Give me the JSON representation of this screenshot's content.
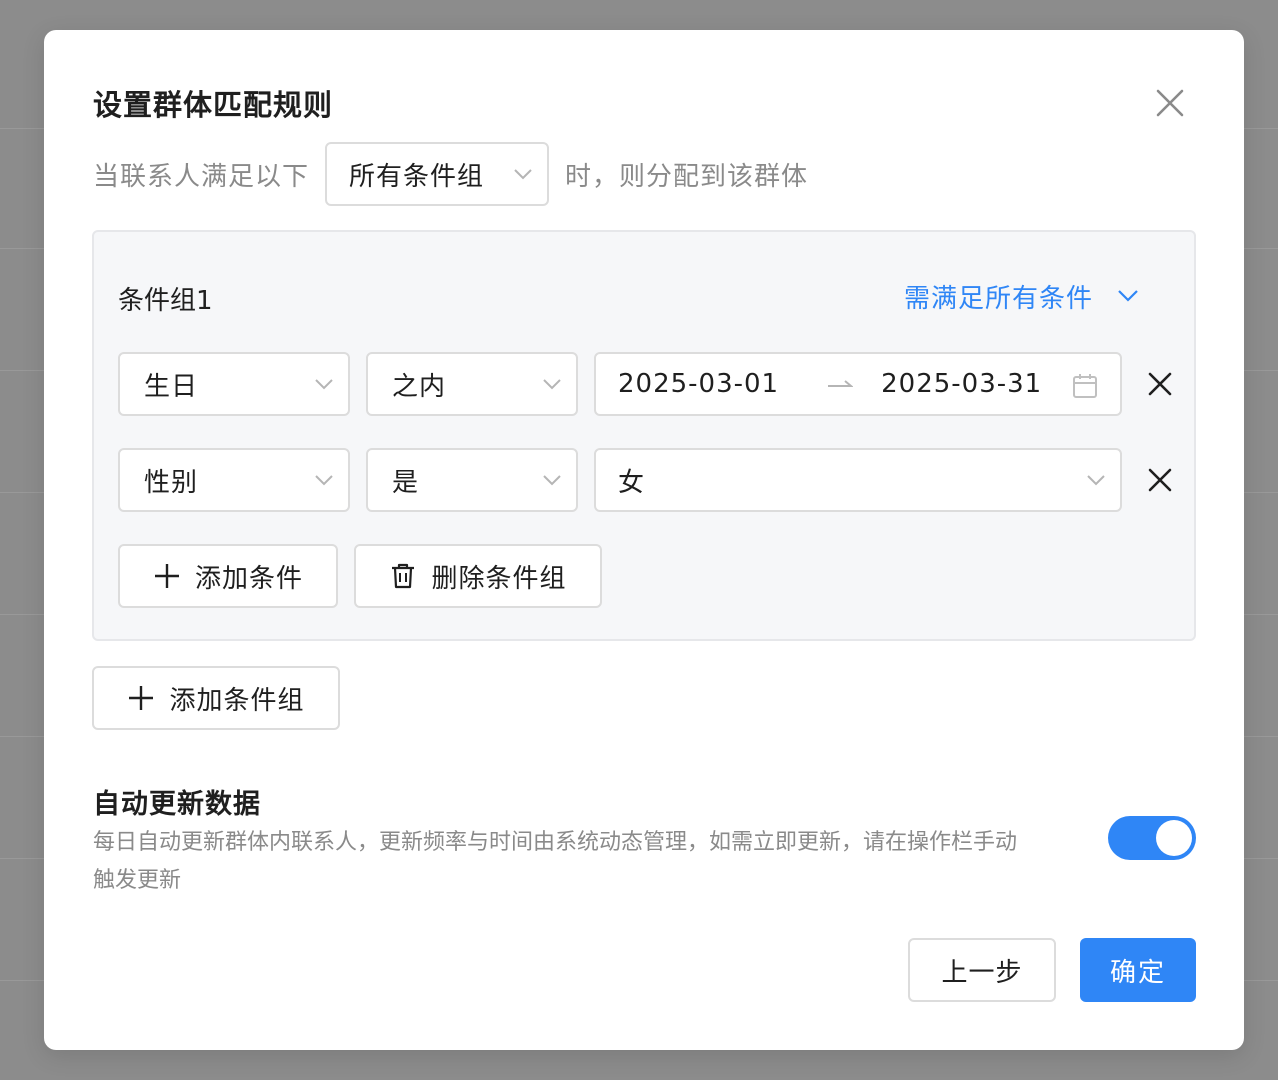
{
  "dialog": {
    "title": "设置群体匹配规则",
    "rule_prefix": "当联系人满足以下",
    "rule_select_value": "所有条件组",
    "rule_suffix": "时，则分配到该群体"
  },
  "condition_group": {
    "title": "条件组1",
    "mode": "需满足所有条件",
    "conditions": [
      {
        "field": "生日",
        "operator": "之内",
        "date_start": "2025-03-01",
        "date_end": "2025-03-31"
      },
      {
        "field": "性别",
        "operator": "是",
        "value": "女"
      }
    ],
    "add_condition_label": "添加条件",
    "delete_group_label": "删除条件组"
  },
  "add_group_label": "添加条件组",
  "auto_update": {
    "title": "自动更新数据",
    "description": "每日自动更新群体内联系人，更新频率与时间由系统动态管理，如需立即更新，请在操作栏手动触发更新",
    "enabled": true
  },
  "footer": {
    "prev_label": "上一步",
    "confirm_label": "确定"
  },
  "colors": {
    "accent": "#2f86f6",
    "overlay": "#8c8c8c"
  }
}
